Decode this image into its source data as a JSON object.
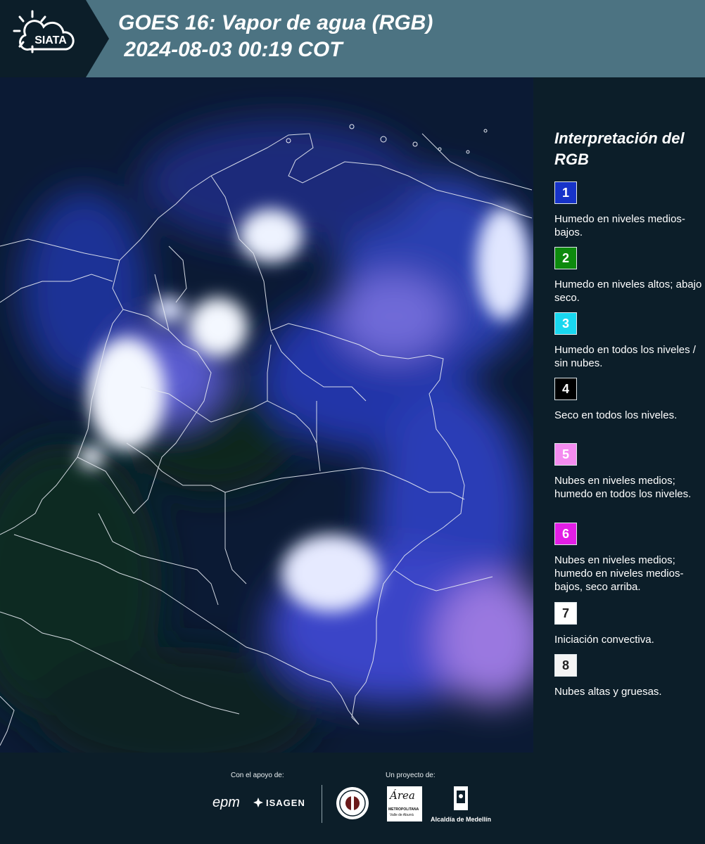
{
  "header": {
    "logo_text": "SIATA",
    "title_line1": "GOES 16: Vapor de agua (RGB)",
    "title_line2": " 2024-08-03 00:19 COT"
  },
  "legend": {
    "title": "Interpretación del RGB",
    "items": [
      {
        "num": "1",
        "color": "#1733c9",
        "num_color": "#ffffff",
        "text": "Humedo en niveles medios-bajos."
      },
      {
        "num": "2",
        "color": "#0d8a0d",
        "num_color": "#ffffff",
        "text": "Humedo en niveles altos; abajo seco."
      },
      {
        "num": "3",
        "color": "#19d7ef",
        "num_color": "#ffffff",
        "text": "Humedo en todos los niveles / sin nubes."
      },
      {
        "num": "4",
        "color": "#000000",
        "num_color": "#ffffff",
        "text": "Seco en todos los niveles."
      },
      {
        "num": "5",
        "color": "#f48cf0",
        "num_color": "#ffffff",
        "text": "Nubes en niveles medios; humedo en todos los niveles."
      },
      {
        "num": "6",
        "color": "#e31ee6",
        "num_color": "#ffffff",
        "text": "Nubes en niveles medios; humedo en niveles medios-bajos, seco arriba."
      },
      {
        "num": "7",
        "color": "#ffffff",
        "num_color": "#222222",
        "text": "Iniciación convectiva."
      },
      {
        "num": "8",
        "color": "#f4f4f4",
        "num_color": "#222222",
        "text": "Nubes altas y gruesas."
      }
    ]
  },
  "footer": {
    "support_label": "Con el apoyo de:",
    "project_label": "Un proyecto de:",
    "sponsor_epm": "epm",
    "sponsor_isagen": "ISAGEN",
    "sponsor_area_line1": "METROPOLITANA",
    "sponsor_area_line2": "Valle de Aburrá",
    "sponsor_area_script": "Área",
    "sponsor_medellin": "Alcaldía de Medellín"
  },
  "colors": {
    "header_bg": "#4c7382",
    "page_bg": "#0c1e29"
  }
}
